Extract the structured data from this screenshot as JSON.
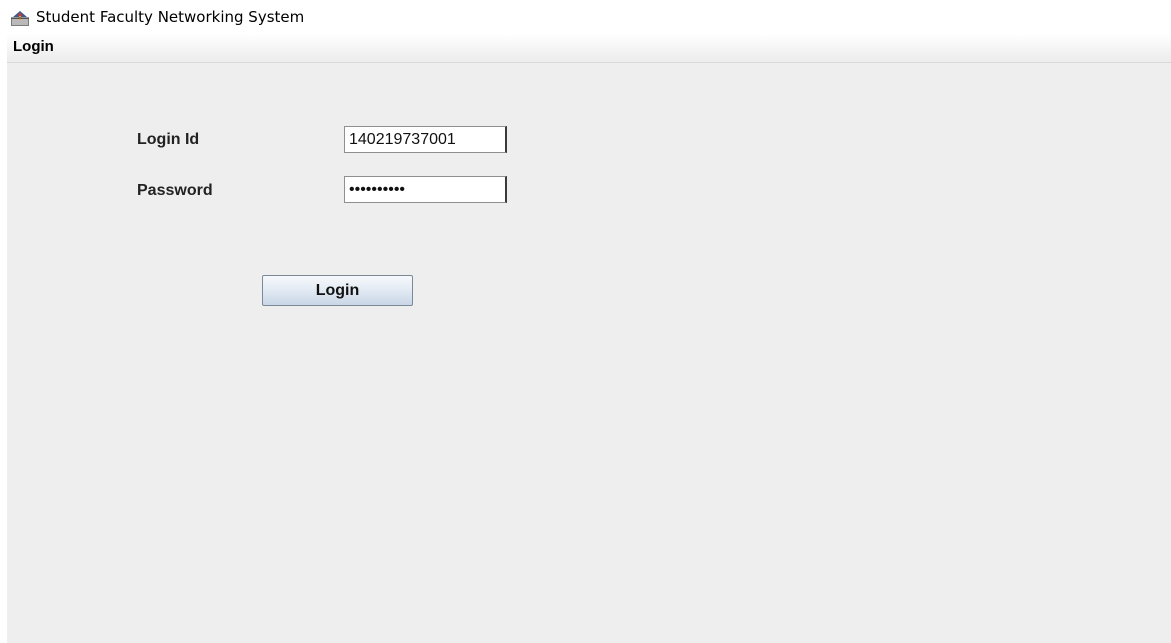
{
  "window": {
    "title": "Student Faculty Networking System",
    "icon": "java-app-icon"
  },
  "menubar": {
    "items": [
      {
        "label": "Login"
      }
    ]
  },
  "form": {
    "login_id_label": "Login Id",
    "login_id_value": "140219737001",
    "password_label": "Password",
    "password_value": "••••••••••",
    "submit_label": "Login"
  },
  "colors": {
    "content_background": "#eeeeee",
    "button_gradient_top": "#f7f9fc",
    "button_gradient_bottom": "#c9d6e6"
  }
}
